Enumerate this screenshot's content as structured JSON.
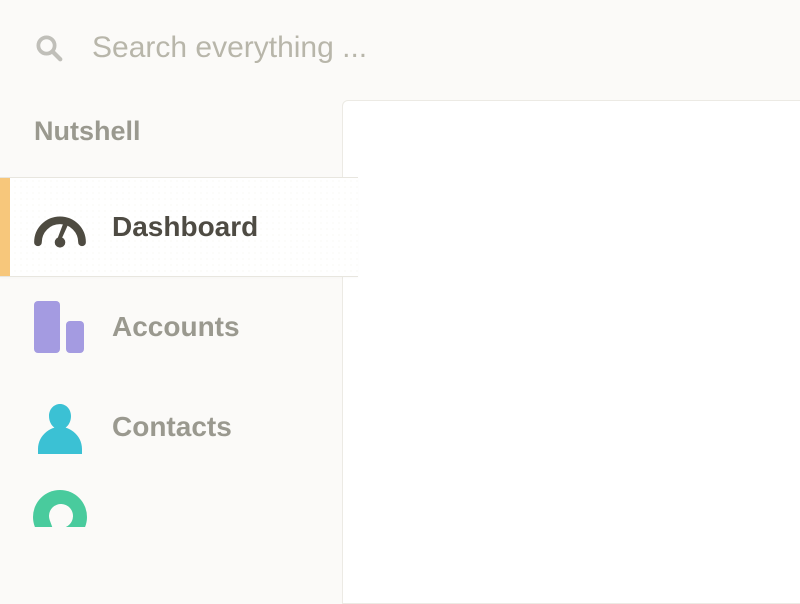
{
  "search": {
    "placeholder": "Search everything ..."
  },
  "sidebar": {
    "title": "Nutshell",
    "items": [
      {
        "label": "Dashboard"
      },
      {
        "label": "Accounts"
      },
      {
        "label": "Contacts"
      },
      {
        "label": ""
      }
    ]
  }
}
